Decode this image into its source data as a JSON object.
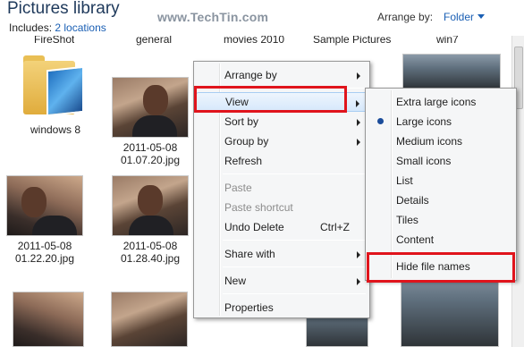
{
  "header": {
    "title": "Pictures library",
    "includes_label": "Includes:",
    "locations_link": "2 locations",
    "watermark": "www.TechTin.com",
    "arrange_by_label": "Arrange by:",
    "arrange_by_value": "Folder"
  },
  "top_labels": [
    "FireShot",
    "general",
    "movies 2010",
    "Sample Pictures",
    "win7"
  ],
  "items": [
    {
      "caption": "windows 8"
    },
    {
      "caption_line1": "2011-05-08",
      "caption_line2": "01.07.20.jpg"
    },
    {
      "caption_line1": "2011-05-08",
      "caption_line2": "01.22.20.jpg"
    },
    {
      "caption_line1": "2011-05-08",
      "caption_line2": "01.28.40.jpg"
    }
  ],
  "context_menu": {
    "items": [
      {
        "label": "Arrange by",
        "submenu": true
      },
      {
        "label": "View",
        "submenu": true
      },
      {
        "label": "Sort by",
        "submenu": true
      },
      {
        "label": "Group by",
        "submenu": true
      },
      {
        "label": "Refresh"
      },
      {
        "label": "Paste",
        "disabled": true
      },
      {
        "label": "Paste shortcut",
        "disabled": true
      },
      {
        "label": "Undo Delete",
        "shortcut": "Ctrl+Z"
      },
      {
        "label": "Share with",
        "submenu": true
      },
      {
        "label": "New",
        "submenu": true
      },
      {
        "label": "Properties"
      }
    ]
  },
  "view_submenu": {
    "items": [
      {
        "label": "Extra large icons"
      },
      {
        "label": "Large icons",
        "selected": true
      },
      {
        "label": "Medium icons"
      },
      {
        "label": "Small icons"
      },
      {
        "label": "List"
      },
      {
        "label": "Details"
      },
      {
        "label": "Tiles"
      },
      {
        "label": "Content"
      },
      {
        "label": "Hide file names"
      }
    ]
  },
  "colors": {
    "highlight_box": "#e0141c",
    "link": "#1a5fb4",
    "radio": "#1b4c9a"
  }
}
